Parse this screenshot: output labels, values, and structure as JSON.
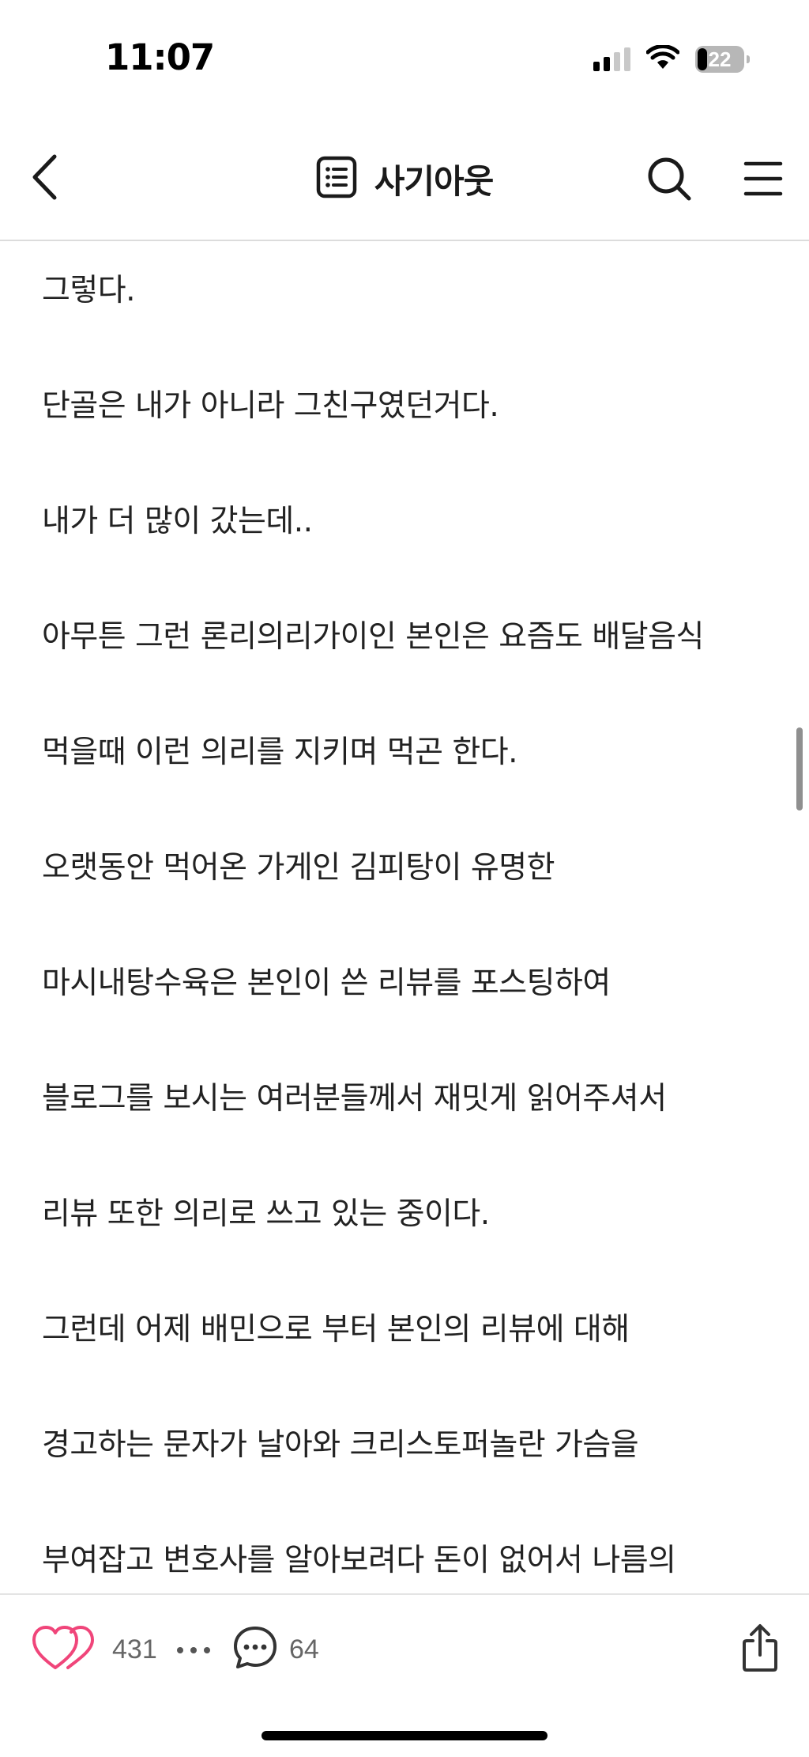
{
  "status_bar": {
    "time": "11:07",
    "battery_level": "22"
  },
  "nav": {
    "title": "사기아웃",
    "back_icon": "chevron-left-icon",
    "list_icon": "list-icon",
    "search_icon": "search-icon",
    "menu_icon": "hamburger-menu-icon"
  },
  "article": {
    "paragraphs": [
      "그렇다.",
      "단골은 내가 아니라 그친구였던거다.",
      "내가 더 많이 갔는데..",
      "아무튼 그런 론리의리가이인 본인은 요즘도 배달음식",
      "먹을때 이런 의리를 지키며 먹곤 한다.",
      "오랫동안 먹어온 가게인 김피탕이 유명한",
      "마시내탕수육은 본인이 쓴 리뷰를 포스팅하여",
      "블로그를 보시는 여러분들께서 재밋게 읽어주셔서",
      "리뷰 또한 의리로 쓰고 있는 중이다.",
      "그런데 어제 배민으로 부터 본인의 리뷰에 대해",
      "경고하는 문자가 날아와 크리스토퍼놀란 가슴을",
      "부여잡고 변호사를 알아보려다 돈이 없어서 나름의"
    ]
  },
  "actions": {
    "like_count": "431",
    "comment_count": "64",
    "like_icon": "heart-icon",
    "more_icon": "more-dots-icon",
    "comment_icon": "comment-bubble-icon",
    "share_icon": "share-icon"
  },
  "colors": {
    "like_heart": "#f0457a",
    "text": "#222222",
    "muted": "#666666",
    "divider": "#dcdcdc"
  }
}
